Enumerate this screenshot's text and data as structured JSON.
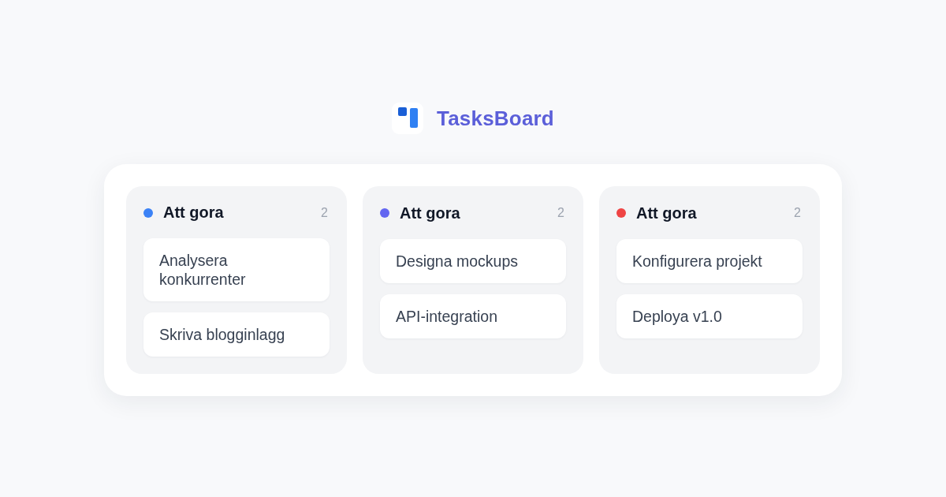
{
  "header": {
    "title": "TasksBoard"
  },
  "columns": [
    {
      "title": "Att gora",
      "count": "2",
      "color": "#3b82f6",
      "cards": [
        "Analysera konkurrenter",
        "Skriva blogginlagg"
      ]
    },
    {
      "title": "Att gora",
      "count": "2",
      "color": "#6366f1",
      "cards": [
        "Designa mockups",
        "API-integration"
      ]
    },
    {
      "title": "Att gora",
      "count": "2",
      "color": "#ef4444",
      "cards": [
        "Konfigurera projekt",
        "Deploya v1.0"
      ]
    }
  ]
}
